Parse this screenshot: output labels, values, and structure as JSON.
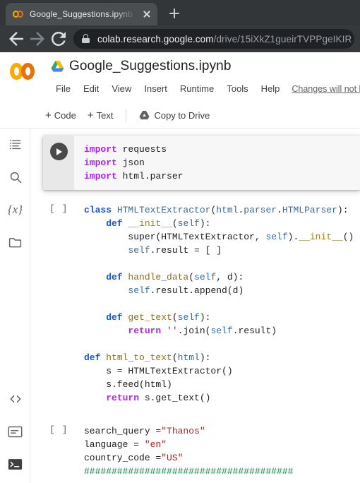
{
  "browser": {
    "tab": {
      "title": "Google_Suggestions.ipynb - Cola",
      "favicon": "colab-icon",
      "close": "close-icon"
    },
    "new_tab_label": "+",
    "nav": {
      "back": "back-arrow-icon",
      "forward": "forward-arrow-icon",
      "reload": "reload-icon"
    },
    "omnibox": {
      "lock": "lock-icon",
      "domain": "colab.research.google.com",
      "path": "/drive/15iXkZ1gueirTVPPgeIKIR"
    }
  },
  "colab": {
    "logo": "colab-logo",
    "drive_icon": "google-drive-icon",
    "doc_title": "Google_Suggestions.ipynb",
    "menus": [
      "File",
      "Edit",
      "View",
      "Insert",
      "Runtime",
      "Tools",
      "Help"
    ],
    "save_note": "Changes will not b",
    "toolbar": {
      "add_code": "Code",
      "add_text": "Text",
      "plus": "+",
      "copy_to_drive": "Copy to Drive"
    },
    "rail": [
      {
        "name": "table-of-contents-icon",
        "label": "Table of contents"
      },
      {
        "name": "search-icon",
        "label": "Find and replace"
      },
      {
        "name": "variables-icon",
        "label": "{x}"
      },
      {
        "name": "files-icon",
        "label": "Files"
      }
    ],
    "rail_bottom": [
      {
        "name": "code-snippets-icon",
        "label": "Code snippets"
      },
      {
        "name": "command-palette-icon",
        "label": "Command palette"
      },
      {
        "name": "terminal-icon",
        "label": "Terminal"
      }
    ]
  },
  "cells": [
    {
      "id": "cell-1",
      "selected": true,
      "prompt": "",
      "run_button": "run-cell-icon",
      "lines": [
        [
          {
            "t": "import",
            "c": "k"
          },
          {
            "t": " requests",
            "c": "pl"
          }
        ],
        [
          {
            "t": "import",
            "c": "k"
          },
          {
            "t": " json",
            "c": "pl"
          }
        ],
        [
          {
            "t": "import",
            "c": "k"
          },
          {
            "t": " html",
            "c": "pl"
          },
          {
            "t": ".",
            "c": "pl"
          },
          {
            "t": "parser",
            "c": "pl"
          }
        ]
      ]
    },
    {
      "id": "cell-2",
      "selected": false,
      "prompt": "[ ]",
      "lines": [
        [
          {
            "t": "class ",
            "c": "kw"
          },
          {
            "t": "HTMLTextExtractor",
            "c": "cls"
          },
          {
            "t": "(",
            "c": "pl"
          },
          {
            "t": "html",
            "c": "cls"
          },
          {
            "t": ".",
            "c": "pl"
          },
          {
            "t": "parser",
            "c": "cls"
          },
          {
            "t": ".",
            "c": "pl"
          },
          {
            "t": "HTMLParser",
            "c": "cls"
          },
          {
            "t": "):",
            "c": "pl"
          }
        ],
        [
          {
            "t": "    def ",
            "c": "kw"
          },
          {
            "t": "__init__",
            "c": "dun"
          },
          {
            "t": "(",
            "c": "pl"
          },
          {
            "t": "self",
            "c": "slf"
          },
          {
            "t": "):",
            "c": "pl"
          }
        ],
        [
          {
            "t": "        super(HTMLTextExtractor, ",
            "c": "pl"
          },
          {
            "t": "self",
            "c": "slf"
          },
          {
            "t": ").",
            "c": "pl"
          },
          {
            "t": "__init__",
            "c": "dun"
          },
          {
            "t": "()",
            "c": "pl"
          }
        ],
        [
          {
            "t": "        ",
            "c": "pl"
          },
          {
            "t": "self",
            "c": "slf"
          },
          {
            "t": ".result = [ ]",
            "c": "pl"
          }
        ],
        [
          {
            "t": "",
            "c": "pl"
          }
        ],
        [
          {
            "t": "    def ",
            "c": "kw"
          },
          {
            "t": "handle_data",
            "c": "fn"
          },
          {
            "t": "(",
            "c": "pl"
          },
          {
            "t": "self",
            "c": "slf"
          },
          {
            "t": ", d):",
            "c": "pl"
          }
        ],
        [
          {
            "t": "        ",
            "c": "pl"
          },
          {
            "t": "self",
            "c": "slf"
          },
          {
            "t": ".result.append(d)",
            "c": "pl"
          }
        ],
        [
          {
            "t": "",
            "c": "pl"
          }
        ],
        [
          {
            "t": "    def ",
            "c": "kw"
          },
          {
            "t": "get_text",
            "c": "fn"
          },
          {
            "t": "(",
            "c": "pl"
          },
          {
            "t": "self",
            "c": "slf"
          },
          {
            "t": "):",
            "c": "pl"
          }
        ],
        [
          {
            "t": "        ",
            "c": "pl"
          },
          {
            "t": "return ",
            "c": "k"
          },
          {
            "t": "''",
            "c": "str"
          },
          {
            "t": ".join(",
            "c": "pl"
          },
          {
            "t": "self",
            "c": "slf"
          },
          {
            "t": ".result)",
            "c": "pl"
          }
        ],
        [
          {
            "t": "",
            "c": "pl"
          }
        ],
        [
          {
            "t": "def ",
            "c": "kw"
          },
          {
            "t": "html_to_text",
            "c": "fn"
          },
          {
            "t": "(",
            "c": "pl"
          },
          {
            "t": "html",
            "c": "cls"
          },
          {
            "t": "):",
            "c": "pl"
          }
        ],
        [
          {
            "t": "    s = HTMLTextExtractor()",
            "c": "pl"
          }
        ],
        [
          {
            "t": "    s.feed(html)",
            "c": "pl"
          }
        ],
        [
          {
            "t": "    ",
            "c": "pl"
          },
          {
            "t": "return ",
            "c": "k"
          },
          {
            "t": "s.get_text()",
            "c": "pl"
          }
        ]
      ]
    },
    {
      "id": "cell-3",
      "selected": false,
      "prompt": "[ ]",
      "lines": [
        [
          {
            "t": "search_query =",
            "c": "pl"
          },
          {
            "t": "\"Thanos\"",
            "c": "str"
          }
        ],
        [
          {
            "t": "language = ",
            "c": "pl"
          },
          {
            "t": "\"en\"",
            "c": "str"
          }
        ],
        [
          {
            "t": "country_code =",
            "c": "pl"
          },
          {
            "t": "\"US\"",
            "c": "str"
          }
        ],
        [
          {
            "t": "######################################",
            "c": "cmt"
          }
        ]
      ]
    }
  ],
  "colors": {
    "browser_tabstrip": "#323639",
    "browser_navbar": "#35393c",
    "omnibox": "#202124",
    "colab_orange": "#f9ab00",
    "colab_orange_dark": "#e8710a",
    "keyword": "#aa22ff",
    "class_keyword": "#1a55cc",
    "string": "#b32020",
    "comment": "#0f8040",
    "cell_selected_bg": "#f7f7f7",
    "gutter_selected_bg": "#e8e8e8"
  }
}
